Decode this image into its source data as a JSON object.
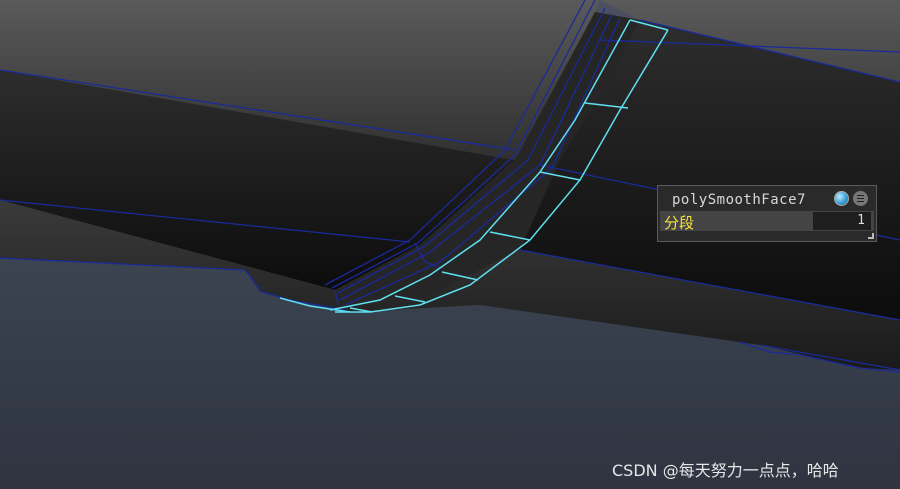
{
  "hud": {
    "node_name": "polySmoothFace7",
    "divisions_label": "分段",
    "divisions_value": "1",
    "icons": [
      "sphere-shading-icon",
      "menu-icon"
    ]
  },
  "watermark": "CSDN @每天努力一点点，哈哈",
  "colors": {
    "wire_dark": "#1a2a9a",
    "wire_selected": "#5fe0f0",
    "hud_label": "#f2e33a",
    "background": "#3e4654"
  }
}
